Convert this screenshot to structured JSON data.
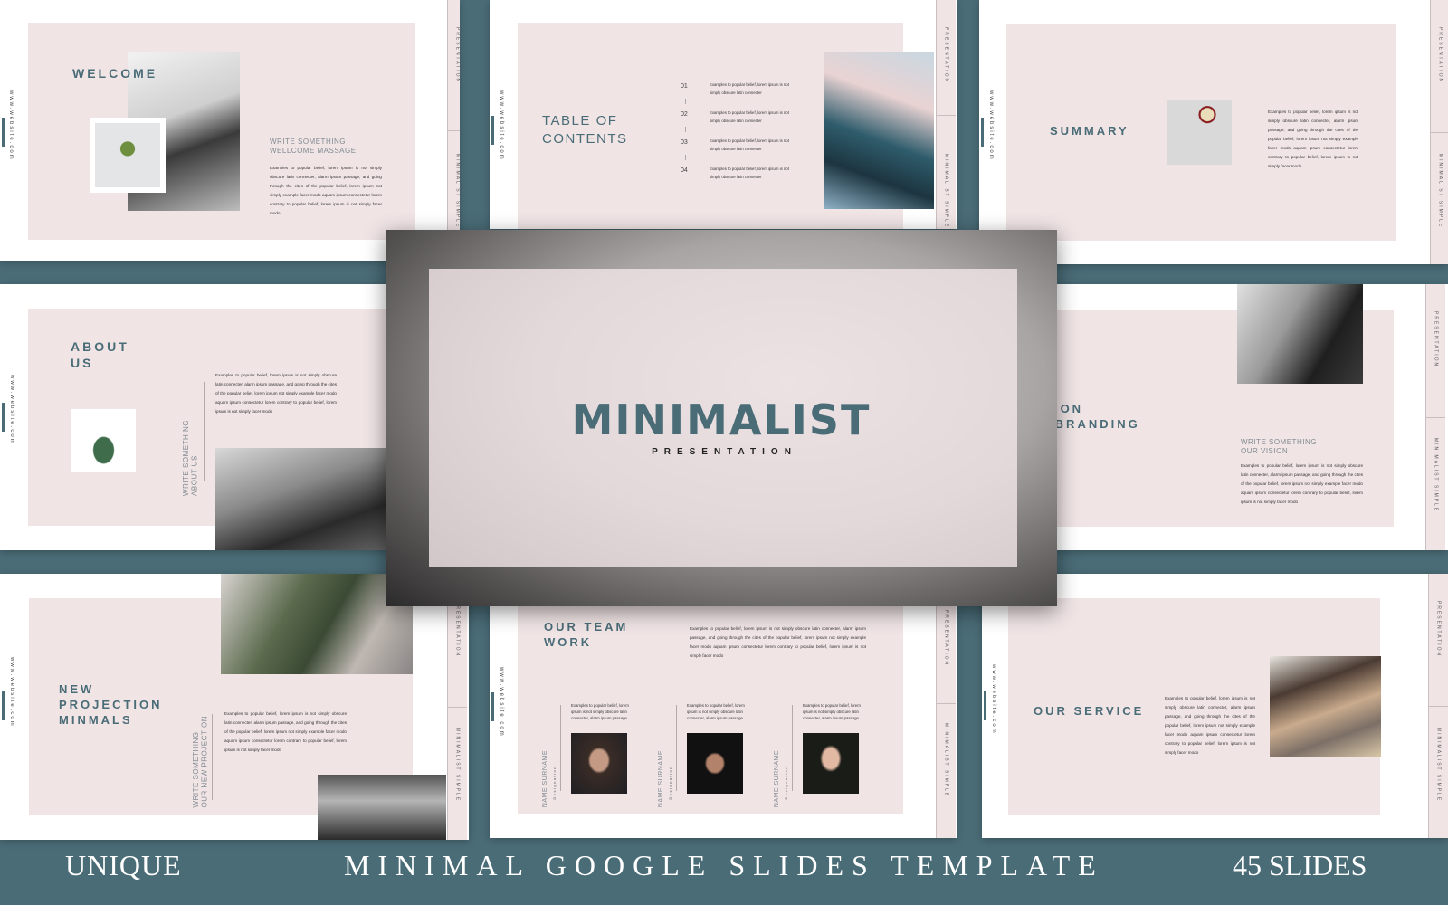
{
  "colors": {
    "accent": "#4a6c77",
    "pink": "#f0e4e5",
    "background": "#4a6c77",
    "text_dark": "#333333"
  },
  "common": {
    "website": "www.website.com",
    "strip_top": "PRESENTATION",
    "strip_bottom": "MINIMALIST SIMPLE",
    "lorem_long": "Examples to popular belief, lorem ipsum is not simply obscure latin connecter, alarm ipsum passage, and going through the cites of the popular belief, lorem ipsum not simply example facer modo aquam ipsum consectetur lorem contrary to popular belief, lorem ipsum is not simply facer modo",
    "lorem_short": "Examples to popular belief, lorem ipsum is not simply obscure latin connecter",
    "lorem_team": "Examples to popular belief, lorem ipsum is not simply obscure latin connecter, alarm ipsum passage"
  },
  "cover": {
    "title": "MINIMALIST",
    "subtitle": "PRESENTATION",
    "image": "woman-face-closeup-photo"
  },
  "slides": {
    "welcome": {
      "title": "WELCOME",
      "subtitle_line1": "WRITE SOMETHING",
      "subtitle_line2": "WELLCOME MASSAGE",
      "images": [
        "dancer-veil-photo",
        "bonsai-plant-photo"
      ]
    },
    "toc": {
      "title_line1": "TABLE OF",
      "title_line2": "CONTENTS",
      "items": [
        {
          "num": "01",
          "text": "Examples to popular belief, lorem ipsum is not simply obscure latin connecter"
        },
        {
          "num": "02",
          "text": "Examples to popular belief, lorem ipsum is not simply obscure latin connecter"
        },
        {
          "num": "03",
          "text": "Examples to popular belief, lorem ipsum is not simply obscure latin connecter"
        },
        {
          "num": "04",
          "text": "Examples to popular belief, lorem ipsum is not simply obscure latin connecter"
        }
      ],
      "image": "glass-skyscraper-photo"
    },
    "summary": {
      "title": "SUMMARY",
      "image": "laptop-coffee-photo"
    },
    "about": {
      "title_line1": "ABOUT",
      "title_line2": "US",
      "side_line1": "WRITE SOMETHING",
      "side_line2": "ABOUT US",
      "images": [
        "aloe-plant-photo",
        "bw-buildings-photo"
      ]
    },
    "vision": {
      "title_line1": "VISION",
      "title_line2": "OF BRANDING",
      "subtitle_line1": "WRITE SOMETHING",
      "subtitle_line2": "OUR VISION",
      "image": "woman-mirror-frame-photo"
    },
    "projection": {
      "title_line1": "NEW",
      "title_line2": "PROJECTION",
      "title_line3": "MINMALS",
      "side_line1": "WRITE SOMETHING",
      "side_line2": "OUR NEW PROJECTION",
      "images": [
        "eucalyptus-vase-photo",
        "woman-hand-over-eyes-photo"
      ]
    },
    "team": {
      "title_line1": "OUR TEAM",
      "title_line2": "WORK",
      "members": [
        {
          "name": "NAME SURNAME",
          "designation": "Designation",
          "photo": "woman-hood-portrait"
        },
        {
          "name": "NAME SURNAME",
          "designation": "Designation",
          "photo": "man-hat-portrait"
        },
        {
          "name": "NAME SURNAME",
          "designation": "Designation",
          "photo": "asian-woman-portrait"
        }
      ]
    },
    "service": {
      "title": "OUR SERVICE",
      "image": "team-meeting-photo"
    }
  },
  "banner": {
    "left": "UNIQUE",
    "center": "MINIMAL GOOGLE SLIDES TEMPLATE",
    "right": "45 SLIDES"
  }
}
